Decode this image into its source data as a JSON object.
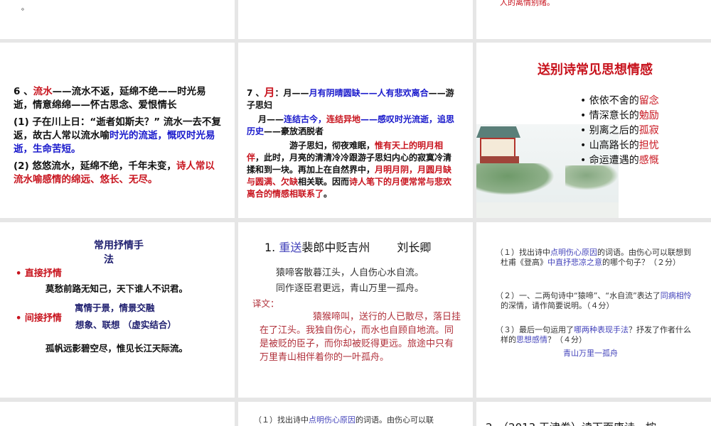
{
  "slides": [
    {
      "id": "partial-top-left",
      "text": "。"
    },
    {
      "id": "partial-top-right",
      "text": "人的离情别绪。"
    },
    {
      "id": "slide-6",
      "line1": {
        "num": "6 、",
        "key": "流水",
        "rest": "——流水不返，延绵不绝——时光易逝，情意绵绵——怀古思念、爱恨情长"
      },
      "p1": {
        "a": "(1) 子在川上日：“逝者如斯夫？” 流水一去不复返，故古人常以流水喻",
        "b": "时光的流逝，慨叹时光易逝，生命苦短。"
      },
      "p2": {
        "a": "(2) 悠悠流水，延绵不绝，千年未变，",
        "b": "诗人常以流水喻感情的绵远、悠长、无尽。"
      }
    },
    {
      "id": "slide-7",
      "l1": {
        "num": "7 、",
        "key": "月",
        "c": "：月——",
        "d": "月有阴晴圆缺——人有悲欢离合",
        "e": "——游子思妇"
      },
      "l2": {
        "a": "月——",
        "b": "连结古今，",
        "c": "连结异地",
        "d": "——感叹时光流逝，追思历史",
        "e": "——豪放洒脱者"
      },
      "l3": {
        "a": "游子思妇，彻夜难眠，",
        "b": "惟有天上的明月相伴",
        "c": "，此时，月亮的清清冷冷跟游子思妇内心的寂寞冷清揉和到一块。再加上在自然界中，",
        "d": "月明月阴，月圆月缺与圆满、欠缺",
        "e": "相关联。因而",
        "f": "诗人笔下的月便常常与悲欢离合的情感相联系了",
        "g": "。"
      }
    },
    {
      "id": "slide-farewell",
      "title": "送别诗常见思想情感",
      "items": [
        {
          "a": "依依不舍的",
          "b": "留念"
        },
        {
          "a": "情深意长的",
          "b": "勉励"
        },
        {
          "a": "别离之后的",
          "b": "孤寂"
        },
        {
          "a": "山高路长的",
          "b": "担忧"
        },
        {
          "a": "命运遭遇的",
          "b": "感慨"
        }
      ]
    },
    {
      "id": "slide-lyric",
      "title1": "常用抒情手",
      "title2": "法",
      "direct": "直接抒情",
      "direct_example": "莫愁前路无知己，天下谁人不识君。",
      "indirect": "间接抒情",
      "indirect_a": "寓情于景，情景交融",
      "indirect_b": "想象、联想 （虚实结合）",
      "indirect_example": "孤帆远影碧空尽，惟见长江天际流。"
    },
    {
      "id": "slide-poem",
      "num": "1. ",
      "title_hl": "重送",
      "title_rest": "裴郎中贬吉州",
      "author": "刘长卿",
      "verse1": "猿啼客散暮江头，人自伤心水自流。",
      "verse2": "同作逐臣君更远，青山万里一孤舟。",
      "trans_label": "译文：",
      "translation": "猿猴啼叫，送行的人已散尽，落日挂在了江头。我独自伤心，而水也自顾自地流。同是被贬的臣子，而你却被贬得更远。旅途中只有万里青山相伴着你的一叶孤舟。"
    },
    {
      "id": "slide-questions",
      "q1": {
        "a": "（１）找出诗中",
        "b": "点明伤心原因",
        "c": "的词语。由伤心可以联想到杜甫《登高》",
        "d": "中直抒悲凉之意",
        "e": "的哪个句子？（２分）"
      },
      "q2": {
        "a": "（２）一、二两句诗中“猿啼”、“水自流”表达了",
        "b": "同病相怜",
        "c": "的深情，请作简要说明。（４分）"
      },
      "q3": {
        "a": "（３）最后一句运用了",
        "b": "哪两种表现手法",
        "c": "？抒发了作者什么样的",
        "d": "思想感情",
        "e": "？（４分）"
      },
      "answer": "青山万里一孤舟"
    },
    {
      "id": "partial-bottom-middle",
      "a": "（１）找出诗中",
      "b": "点明伤心原因",
      "c": "的词语。由伤心可以联"
    },
    {
      "id": "partial-bottom-right",
      "text": "2．（2013·天津卷）读下面唐诗，按"
    }
  ]
}
